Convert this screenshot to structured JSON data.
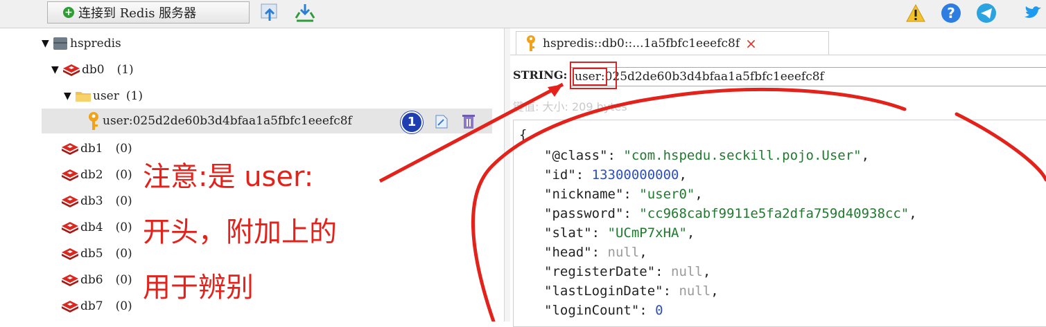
{
  "toolbar": {
    "connect_label": "连接到 Redis 服务器"
  },
  "tree": {
    "server": "hspredis",
    "db0": {
      "label": "db0",
      "count": "(1)"
    },
    "folder": {
      "label": "user",
      "count": "(1)"
    },
    "selected_key": "user:025d2de60b3d4bfaa1a5fbfc1eeefc8f",
    "badge": "1",
    "dbs": [
      {
        "label": "db1",
        "count": "(0)"
      },
      {
        "label": "db2",
        "count": "(0)"
      },
      {
        "label": "db3",
        "count": "(0)"
      },
      {
        "label": "db4",
        "count": "(0)"
      },
      {
        "label": "db5",
        "count": "(0)"
      },
      {
        "label": "db6",
        "count": "(0)"
      },
      {
        "label": "db7",
        "count": "(0)"
      }
    ]
  },
  "tab": {
    "title": "hspredis::db0::...1a5fbfc1eeefc8f",
    "close": "×"
  },
  "key_view": {
    "type": "STRING:",
    "prefix": "user:",
    "rest": "025d2de60b3d4bfaa1a5fbfc1eeefc8f",
    "meta": "键值: 大小: 209 bytes"
  },
  "value": {
    "open": "{",
    "lines": [
      {
        "key": "\"@class\"",
        "value": "\"com.hspedu.seckill.pojo.User\"",
        "kind": "s",
        "end": ","
      },
      {
        "key": "\"id\"",
        "value": "13300000000",
        "kind": "n",
        "end": ","
      },
      {
        "key": "\"nickname\"",
        "value": "\"user0\"",
        "kind": "s",
        "end": ","
      },
      {
        "key": "\"password\"",
        "value": "\"cc968cabf9911e5fa2dfa759d40938cc\"",
        "kind": "s",
        "end": ","
      },
      {
        "key": "\"slat\"",
        "value": "\"UCmP7xHA\"",
        "kind": "s",
        "end": ","
      },
      {
        "key": "\"head\"",
        "value": "null",
        "kind": "nl",
        "end": ","
      },
      {
        "key": "\"registerDate\"",
        "value": "null",
        "kind": "nl",
        "end": ","
      },
      {
        "key": "\"lastLoginDate\"",
        "value": "null",
        "kind": "nl",
        "end": ","
      },
      {
        "key": "\"loginCount\"",
        "value": "0",
        "kind": "n",
        "end": ""
      }
    ]
  },
  "annotation": {
    "lines": [
      "注意:是 user:",
      "开头，附加上的",
      "用于辨别"
    ],
    "color": "#e3231b"
  }
}
